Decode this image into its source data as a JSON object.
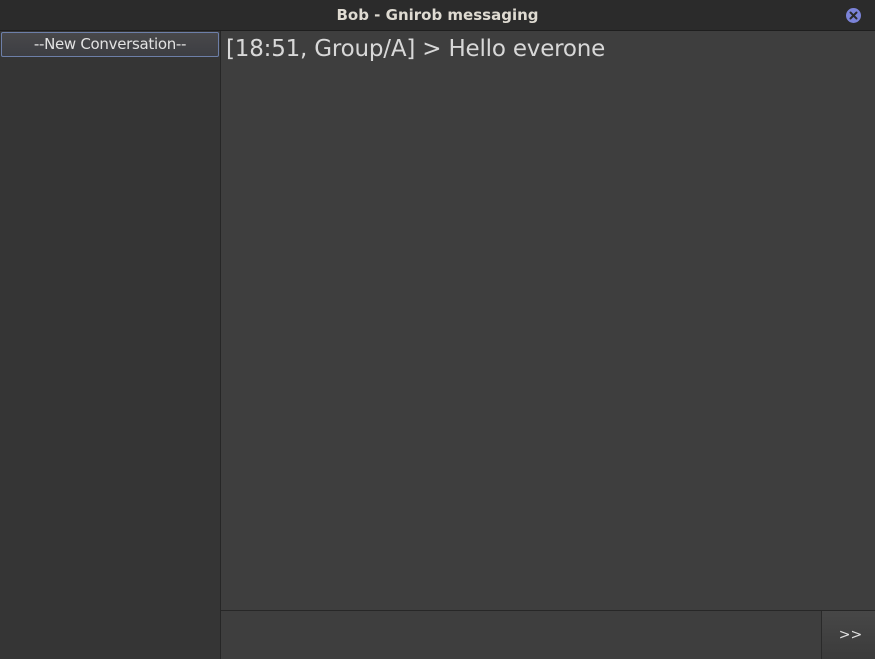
{
  "window": {
    "title": "Bob - Gnirob messaging"
  },
  "sidebar": {
    "new_conversation_label": "--New Conversation--"
  },
  "chat": {
    "messages": [
      {
        "text": "[18:51, Group/A] > Hello everone"
      }
    ]
  },
  "composer": {
    "input_value": "",
    "send_label": ">>"
  },
  "colors": {
    "close_button": "#7b83d8",
    "button_border_accent": "#6d7fa8"
  }
}
